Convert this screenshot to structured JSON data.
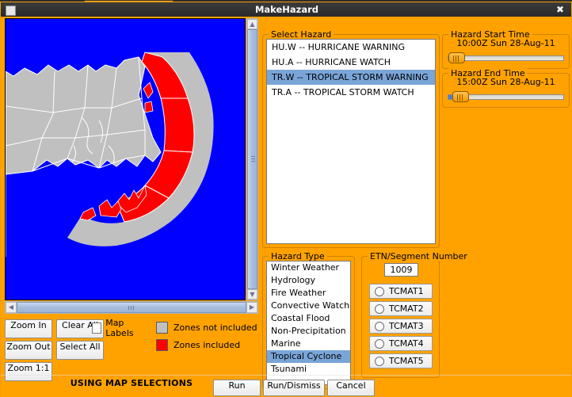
{
  "window": {
    "title": "MakeHazard",
    "close_icon": "close-icon",
    "close_glyph": "✖"
  },
  "map": {
    "ocean_color": "#0000ff",
    "land_color": "#c0c0c0",
    "selected_color": "#ff0000",
    "outline_color": "#ffffff",
    "status_text": "USING MAP SELECTIONS",
    "buttons": {
      "zoom_in": "Zoom In",
      "clear_all": "Clear All",
      "zoom_out": "Zoom Out",
      "select_all": "Select All",
      "zoom_11": "Zoom 1:1"
    },
    "map_labels": {
      "label": "Map Labels",
      "checked": false
    },
    "legend": [
      {
        "swatch": "#c0c0c0",
        "label": "Zones not included"
      },
      {
        "swatch": "#ff0000",
        "label": "Zones included"
      }
    ]
  },
  "select_hazard": {
    "title": "Select Hazard",
    "items": [
      {
        "label": "HU.W -- HURRICANE WARNING",
        "selected": false
      },
      {
        "label": "HU.A -- HURRICANE WATCH",
        "selected": false
      },
      {
        "label": "TR.W -- TROPICAL STORM WARNING",
        "selected": true
      },
      {
        "label": "TR.A -- TROPICAL STORM WATCH",
        "selected": false
      }
    ],
    "selection_color": "#7aa5d8"
  },
  "hazard_start_time": {
    "title": "Hazard Start Time",
    "value": "10:00Z Sun 28-Aug-11",
    "slider_percent": 2,
    "fill_percent": 0
  },
  "hazard_end_time": {
    "title": "Hazard End Time",
    "value": "15:00Z Sun 28-Aug-11",
    "slider_percent": 5,
    "fill_percent": 4
  },
  "hazard_type": {
    "title": "Hazard Type",
    "items": [
      {
        "label": "Winter Weather",
        "selected": false
      },
      {
        "label": "Hydrology",
        "selected": false
      },
      {
        "label": "Fire Weather",
        "selected": false
      },
      {
        "label": "Convective Watches",
        "selected": false
      },
      {
        "label": "Coastal Flood",
        "selected": false
      },
      {
        "label": "Non-Precipitation",
        "selected": false
      },
      {
        "label": "Marine",
        "selected": false
      },
      {
        "label": "Tropical Cyclone",
        "selected": true
      },
      {
        "label": "Tsunami",
        "selected": false
      }
    ]
  },
  "etn_segment": {
    "title": "ETN/Segment Number",
    "value": "1009",
    "options": [
      {
        "label": "TCMAT1",
        "checked": false
      },
      {
        "label": "TCMAT2",
        "checked": false
      },
      {
        "label": "TCMAT3",
        "checked": false
      },
      {
        "label": "TCMAT4",
        "checked": false
      },
      {
        "label": "TCMAT5",
        "checked": false
      }
    ]
  },
  "footer": {
    "run": "Run",
    "run_dismiss": "Run/Dismiss",
    "cancel": "Cancel"
  },
  "theme": {
    "background": "#ffa200",
    "titlebar": "#2e2e2e",
    "group_border": "#d08200"
  }
}
